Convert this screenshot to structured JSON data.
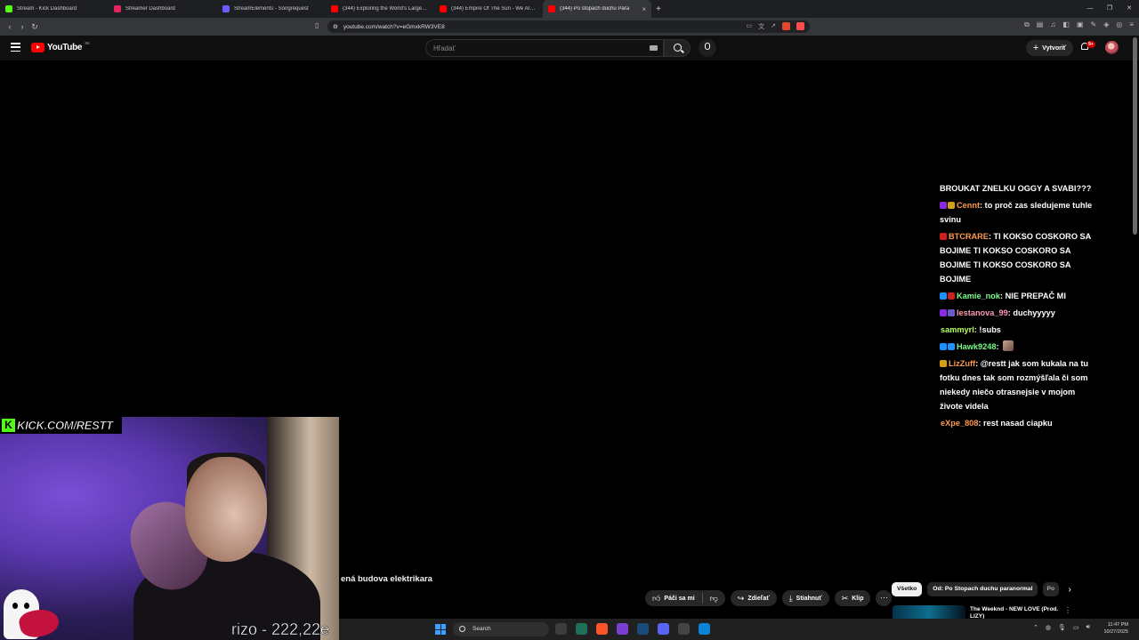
{
  "browser": {
    "tabs": [
      {
        "label": "Stream - Kick Dashboard",
        "icon": "kick-icon",
        "color": "#53fc18",
        "active": false
      },
      {
        "label": "Streamer Dashboard",
        "icon": "streamer-icon",
        "color": "#e5245e",
        "active": false
      },
      {
        "label": "StreamElements - Songrequest",
        "icon": "streamelements-icon",
        "color": "#6b5cff",
        "active": false
      },
      {
        "label": "(344) Exploring the World's Largest S",
        "icon": "youtube-icon",
        "color": "#ff0000",
        "active": false
      },
      {
        "label": "(344) Empire Of The Sun - We Are Th",
        "icon": "youtube-icon",
        "color": "#ff0000",
        "active": false
      },
      {
        "label": "(344) Po stopach duchu Para",
        "icon": "youtube-icon",
        "color": "#ff0000",
        "active": true
      }
    ],
    "url": "youtube.com/watch?v=eGmxkRW3VE8",
    "new_tab": "+",
    "close_tab": "×"
  },
  "youtube": {
    "logo_text": "YouTube",
    "logo_country": "SK",
    "search_placeholder": "Hľadať",
    "create_label": "Vytvoriť",
    "notif_badge": "9+",
    "video_title": "ená budova elektrikara",
    "actions": {
      "like": "Páči sa mi",
      "share": "Zdieľať",
      "download": "Stiahnuť",
      "clip": "Klip",
      "more": "···"
    },
    "chips": {
      "all": "Všetko",
      "from_channel": "Od: Po Stopach duchu paranormal",
      "cut": "Po"
    },
    "recommendation": {
      "title": "The Weeknd - NEW LOVE (Prod. LIZY)"
    }
  },
  "chat": {
    "messages": [
      {
        "user": "",
        "user_color": "#ffffff",
        "text": "BROUKAT ZNELKU OGGY A SVABI???",
        "badges": []
      },
      {
        "user": "Cennt",
        "user_color": "#ff9a4d",
        "text": ": to proč zas sledujeme tuhle svinu",
        "badges": [
          "#8a2be2",
          "#d4a017"
        ]
      },
      {
        "user": "BTCRARE",
        "user_color": "#ff9a4d",
        "text": ": TI KOKSO COSKORO SA BOJIME  TI KOKSO COSKORO SA BOJIME  TI KOKSO COSKORO SA BOJIME",
        "badges": [
          "#cc1f1f"
        ]
      },
      {
        "user": "Kamie_nok",
        "user_color": "#7cfc8a",
        "text": ": NIE PREPAČ MI",
        "badges": [
          "#1e90ff",
          "#cc1f1f"
        ]
      },
      {
        "user": "lestanova_99",
        "user_color": "#ff9eb5",
        "text": ": duchyyyyy",
        "badges": [
          "#8a2be2",
          "#6a5acd"
        ]
      },
      {
        "user": "sammyrl",
        "user_color": "#b6ff5a",
        "text": ": !subs",
        "badges": []
      },
      {
        "user": "Hawk9248",
        "user_color": "#7cfc8a",
        "text": ": ",
        "badges": [
          "#1e90ff",
          "#1e90ff"
        ]
      },
      {
        "user": "LizZuff",
        "user_color": "#ff9a4d",
        "text": ": @restt jak som kukala na tu fotku dnes tak som rozmýšľala či som niekedy niečo otrasnejsie v mojom živote videla",
        "badges": [
          "#d4a017"
        ]
      },
      {
        "user": "eXpe_808",
        "user_color": "#ff9a4d",
        "text": ": rest nasad ciapku",
        "badges": []
      }
    ]
  },
  "overlay": {
    "kick_url": "KICK.COM/RESTT",
    "donation": "rizo - 222,22e"
  },
  "taskbar": {
    "search": "Search",
    "time": "11:47 PM",
    "date": "10/27/2025"
  }
}
